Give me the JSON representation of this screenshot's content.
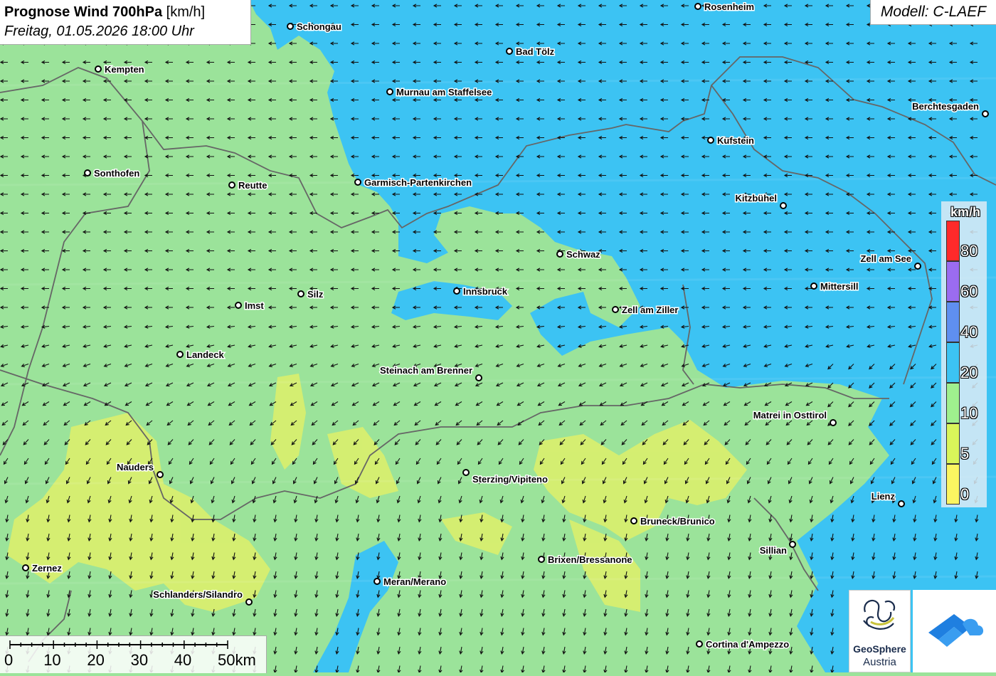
{
  "header": {
    "title_bold": "Prognose Wind 700hPa",
    "title_unit": "[km/h]",
    "subtitle": "Freitag, 01.05.2026 18:00 Uhr"
  },
  "model_label": "Modell: C-LAEF",
  "legend": {
    "unit": "km/h",
    "bins": [
      {
        "label": "80",
        "color": "#ff2a2a"
      },
      {
        "label": "60",
        "color": "#9b6cf0"
      },
      {
        "label": "40",
        "color": "#5f8ff0"
      },
      {
        "label": "20",
        "color": "#3cc3f3"
      },
      {
        "label": "10",
        "color": "#9ff08e"
      },
      {
        "label": "5",
        "color": "#d9f55a"
      },
      {
        "label": "0",
        "color": "#fbf561"
      }
    ]
  },
  "scale_bar": {
    "labels": [
      "0",
      "10",
      "20",
      "30",
      "40",
      "50km"
    ]
  },
  "cities": [
    {
      "name": "Rosenheim"
    },
    {
      "name": "Schongau"
    },
    {
      "name": "Bad Tölz"
    },
    {
      "name": "Kempten"
    },
    {
      "name": "Murnau am Staffelsee"
    },
    {
      "name": "Berchtesgaden"
    },
    {
      "name": "Kufstein"
    },
    {
      "name": "Sonthofen"
    },
    {
      "name": "Reutte"
    },
    {
      "name": "Garmisch-Partenkirchen"
    },
    {
      "name": "Kitzbühel"
    },
    {
      "name": "Schwaz"
    },
    {
      "name": "Zell am See"
    },
    {
      "name": "Mittersill"
    },
    {
      "name": "Innsbruck"
    },
    {
      "name": "Silz"
    },
    {
      "name": "Imst"
    },
    {
      "name": "Zell am Ziller"
    },
    {
      "name": "Landeck"
    },
    {
      "name": "Steinach am Brenner"
    },
    {
      "name": "Matrei in Osttirol"
    },
    {
      "name": "Nauders"
    },
    {
      "name": "Sterzing/Vipiteno"
    },
    {
      "name": "Lienz"
    },
    {
      "name": "Bruneck/Brunico"
    },
    {
      "name": "Sillian"
    },
    {
      "name": "Brixen/Bressanone"
    },
    {
      "name": "Zernez"
    },
    {
      "name": "Meran/Merano"
    },
    {
      "name": "Schlanders/Silandro"
    },
    {
      "name": "Cortina d'Ampezzo"
    }
  ],
  "logos": {
    "geosphere_line1": "GeoSphere",
    "geosphere_line2": "Austria"
  },
  "colors": {
    "wind_arrow": "#111111",
    "border_line": "#666666"
  }
}
